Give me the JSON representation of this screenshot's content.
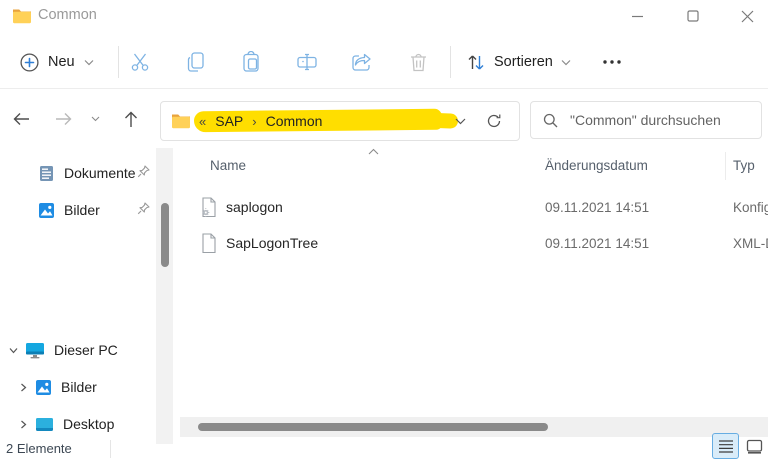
{
  "window": {
    "title": "Common"
  },
  "toolbar": {
    "new_label": "Neu",
    "sort_label": "Sortieren"
  },
  "navigation": {
    "breadcrumb": {
      "prefix": "«",
      "segment1": "SAP",
      "separator": "›",
      "segment2": "Common"
    },
    "search_placeholder": "\"Common\" durchsuchen"
  },
  "sidebar": {
    "quick_access": [
      {
        "label": "Dokumente",
        "icon": "document-icon",
        "pinned": true
      },
      {
        "label": "Bilder",
        "icon": "picture-icon",
        "pinned": true
      }
    ],
    "tree": [
      {
        "label": "Dieser PC",
        "icon": "computer-icon",
        "expanded": true
      },
      {
        "label": "Bilder",
        "icon": "picture-icon",
        "expanded": false
      },
      {
        "label": "Desktop",
        "icon": "desktop-icon",
        "expanded": false
      }
    ]
  },
  "main": {
    "columns": {
      "name": "Name",
      "modified": "Änderungsdatum",
      "type": "Typ"
    },
    "rows": [
      {
        "name": "saplogon",
        "modified": "09.11.2021 14:51",
        "type": "Konfig",
        "icon": "config-file-icon"
      },
      {
        "name": "SapLogonTree",
        "modified": "09.11.2021 14:51",
        "type": "XML-D",
        "icon": "xml-file-icon"
      }
    ]
  },
  "statusbar": {
    "count": "2 Elemente"
  },
  "colors": {
    "highlight_yellow": "#ffde00",
    "accent_blue": "#2f7fd6",
    "toolbar_icon_blue": "#7eb3e3",
    "disabled_gray": "#c3c3c3",
    "folder_yellow": "#ffd158",
    "folder_amber": "#e8a33d",
    "view_toggle_bg": "#d9ecf9",
    "view_toggle_border": "#67ade2"
  }
}
